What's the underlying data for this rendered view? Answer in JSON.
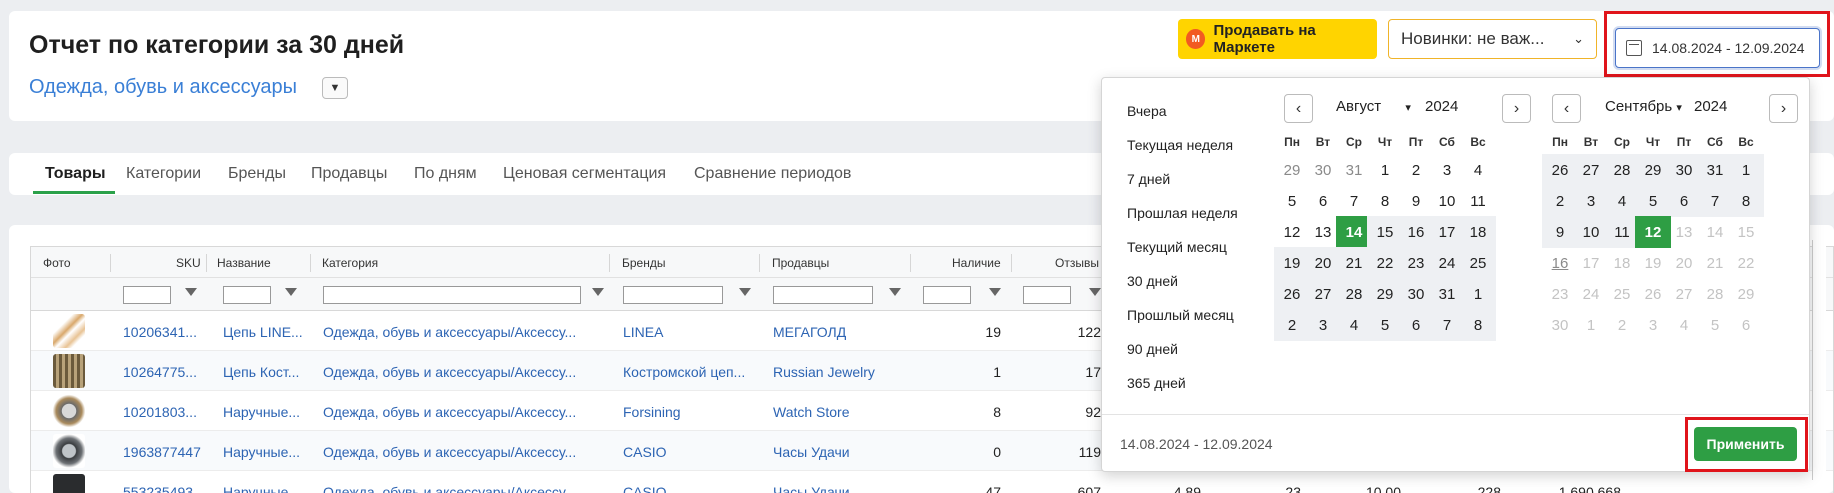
{
  "header": {
    "title": "Отчет по категории за 30 дней",
    "category": "Одежда, обувь и аксессуары",
    "market_button": "Продавать на Маркете",
    "novelty_select": "Новинки: не важ...",
    "date_range": "14.08.2024 - 12.09.2024"
  },
  "tabs": [
    "Товары",
    "Категории",
    "Бренды",
    "Продавцы",
    "По дням",
    "Ценовая сегментация",
    "Сравнение периодов"
  ],
  "table": {
    "columns": [
      "Фото",
      "SKU",
      "Название",
      "Категория",
      "Бренды",
      "Продавцы",
      "Наличие",
      "Отзывы"
    ],
    "rows": [
      {
        "sku": "10206341...",
        "name": "Цепь LINE...",
        "category": "Одежда, обувь и аксессуары/Аксессу...",
        "brand": "LINEA",
        "seller": "МЕГАГОЛД",
        "stock": "19",
        "reviews": "122"
      },
      {
        "sku": "10264775...",
        "name": "Цепь Кост...",
        "category": "Одежда, обувь и аксессуары/Аксессу...",
        "brand": "Костромской цеп...",
        "seller": "Russian Jewelry",
        "stock": "1",
        "reviews": "17"
      },
      {
        "sku": "10201803...",
        "name": "Наручные...",
        "category": "Одежда, обувь и аксессуары/Аксессу...",
        "brand": "Forsining",
        "seller": "Watch Store",
        "stock": "8",
        "reviews": "92"
      },
      {
        "sku": "1963877447",
        "name": "Наручные...",
        "category": "Одежда, обувь и аксессуары/Аксессу...",
        "brand": "CASIO",
        "seller": "Часы Удачи",
        "stock": "0",
        "reviews": "119"
      },
      {
        "sku": "553235493",
        "name": "Наручные...",
        "category": "Одежда, обувь и аксессуары/Аксессу...",
        "brand": "CASIO",
        "seller": "Часы Удачи",
        "stock": "47",
        "reviews": "607",
        "extra": [
          "4,89",
          "23",
          "10,00",
          "228",
          "1 690 668"
        ]
      }
    ]
  },
  "datepicker": {
    "presets": [
      "Вчера",
      "Текущая неделя",
      "7 дней",
      "Прошлая неделя",
      "Текущий месяц",
      "30 дней",
      "Прошлый месяц",
      "90 дней",
      "365 дней"
    ],
    "weekdays": [
      "Пн",
      "Вт",
      "Ср",
      "Чт",
      "Пт",
      "Сб",
      "Вс"
    ],
    "left": {
      "month": "Август",
      "year": "2024",
      "weeks": [
        [
          "29",
          "30",
          "31",
          "1",
          "2",
          "3",
          "4"
        ],
        [
          "5",
          "6",
          "7",
          "8",
          "9",
          "10",
          "11"
        ],
        [
          "12",
          "13",
          "14",
          "15",
          "16",
          "17",
          "18"
        ],
        [
          "19",
          "20",
          "21",
          "22",
          "23",
          "24",
          "25"
        ],
        [
          "26",
          "27",
          "28",
          "29",
          "30",
          "31",
          "1"
        ],
        [
          "2",
          "3",
          "4",
          "5",
          "6",
          "7",
          "8"
        ]
      ]
    },
    "right": {
      "month": "Сентябрь",
      "year": "2024",
      "weeks": [
        [
          "26",
          "27",
          "28",
          "29",
          "30",
          "31",
          "1"
        ],
        [
          "2",
          "3",
          "4",
          "5",
          "6",
          "7",
          "8"
        ],
        [
          "9",
          "10",
          "11",
          "12",
          "13",
          "14",
          "15"
        ],
        [
          "16",
          "17",
          "18",
          "19",
          "20",
          "21",
          "22"
        ],
        [
          "23",
          "24",
          "25",
          "26",
          "27",
          "28",
          "29"
        ],
        [
          "30",
          "1",
          "2",
          "3",
          "4",
          "5",
          "6"
        ]
      ]
    },
    "footer_range": "14.08.2024 - 12.09.2024",
    "apply": "Применить"
  },
  "colors": {
    "accent": "#2e9e44",
    "link": "#2d64b3",
    "highlight": "#e0141b",
    "market": "#ffd400"
  }
}
